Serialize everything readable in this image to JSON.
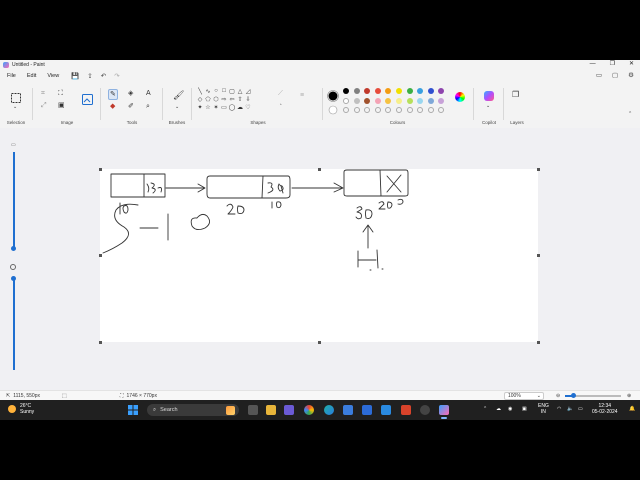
{
  "window": {
    "title": "Untitled - Paint",
    "min": "—",
    "max": "❐",
    "close": "✕"
  },
  "menu": {
    "file": "File",
    "edit": "Edit",
    "view": "View"
  },
  "ribbon": {
    "groups": {
      "selection": "Selection",
      "image": "Image",
      "tools": "Tools",
      "brushes": "Brushes",
      "shapes": "Shapes",
      "colours": "Colours",
      "copilot": "Copilot",
      "layers": "Layers"
    },
    "colours": {
      "primary": "#000000",
      "row1": [
        "#000000",
        "#808080",
        "#c0392b",
        "#e74c3c",
        "#f39c12",
        "#f1e000",
        "#3cb043",
        "#3aa0e0",
        "#3050d0",
        "#8e44ad"
      ],
      "row2": [
        "#ffffff",
        "#c0c0c0",
        "#a0522d",
        "#f4a3b5",
        "#f5c242",
        "#f7ef8a",
        "#b6e05a",
        "#9ad7f0",
        "#7fa8d8",
        "#c8a2d8"
      ]
    }
  },
  "status": {
    "cursor_position": "1115, 550px",
    "image_size": "1746 × 770px",
    "zoom": "100%"
  },
  "zoom_slider": {
    "fraction": 0.15
  },
  "taskbar": {
    "weather_temp": "26°C",
    "weather_desc": "Sunny",
    "search_placeholder": "Search",
    "lang_line1": "ENG",
    "lang_line2": "IN",
    "time": "12:34",
    "date": "05-02-2024"
  },
  "icons": {
    "app": "paint-icon",
    "start": "windows-start-icon",
    "search": "search-icon"
  }
}
